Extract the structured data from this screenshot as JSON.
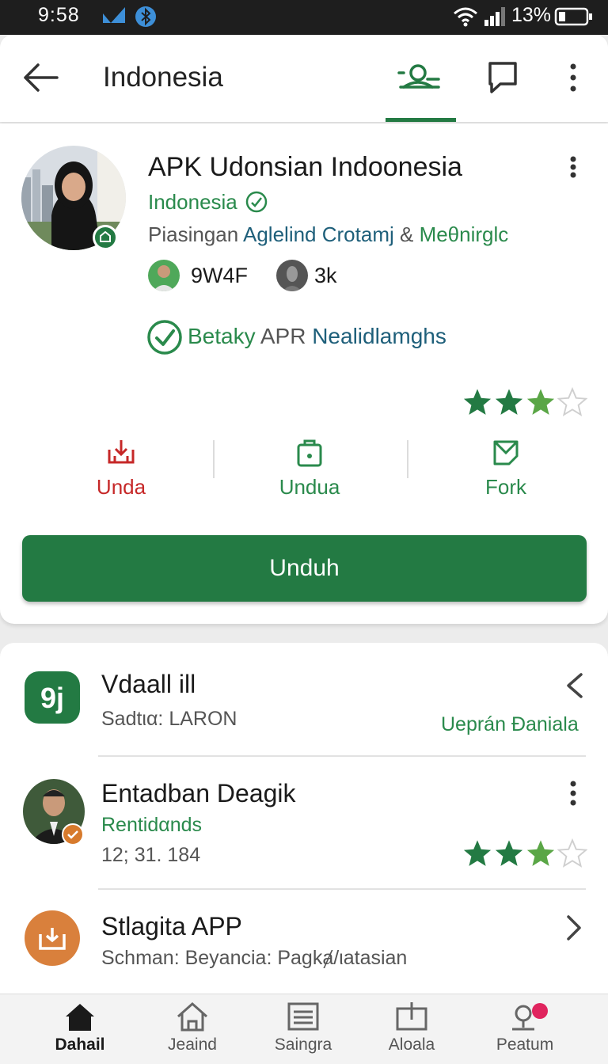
{
  "status_bar": {
    "time": "9:58",
    "battery": "13%"
  },
  "app_bar": {
    "title": "Indonesia"
  },
  "hero": {
    "app_title": "APK Udonsian Indoonesia",
    "developer": "Indonesia",
    "categories": [
      "Piasingan",
      "Aglelind Crotamj",
      "&",
      "Meθnirglc"
    ],
    "stats": [
      {
        "value": "9W4F"
      },
      {
        "value": "3k"
      }
    ],
    "badge": [
      "Betaky",
      "APR",
      "Nealidlamghs"
    ],
    "rating": 3,
    "actions": [
      {
        "label": "Unda",
        "icon": "download-icon",
        "color": "#c62828"
      },
      {
        "label": "Undua",
        "icon": "bag-icon",
        "color": "#2a8a4c"
      },
      {
        "label": "Fork",
        "icon": "fork-icon",
        "color": "#2a8a4c"
      }
    ],
    "primary_button": "Unduh"
  },
  "list": [
    {
      "title": "Vdaall ill",
      "subtitle": "Sadtια: LARON",
      "extra": "Ueprán Đaniala",
      "icon": "app-logo-9j",
      "icon_text": "9j"
    },
    {
      "title": "Entadban Deagik",
      "subtitle_green": "Rentidαnds",
      "subtitle": "12;  31. 184",
      "rating": 3
    },
    {
      "title": "Stlagita APP",
      "subtitle": "Schman: Beyancia: Pagkⱥ/ιatasian",
      "icon": "inbox-icon"
    }
  ],
  "bottom_nav": [
    {
      "label": "Dahail",
      "icon": "home-icon",
      "active": true
    },
    {
      "label": "Jeaind",
      "icon": "house-outline-icon",
      "active": false
    },
    {
      "label": "Saingra",
      "icon": "list-box-icon",
      "active": false
    },
    {
      "label": "Aloala",
      "icon": "upload-box-icon",
      "active": false
    },
    {
      "label": "Peatum",
      "icon": "profile-icon",
      "active": false
    }
  ],
  "colors": {
    "accent": "#237a43",
    "red": "#c62828",
    "star_full": "#237a43",
    "star_partial": "#5aa646"
  }
}
